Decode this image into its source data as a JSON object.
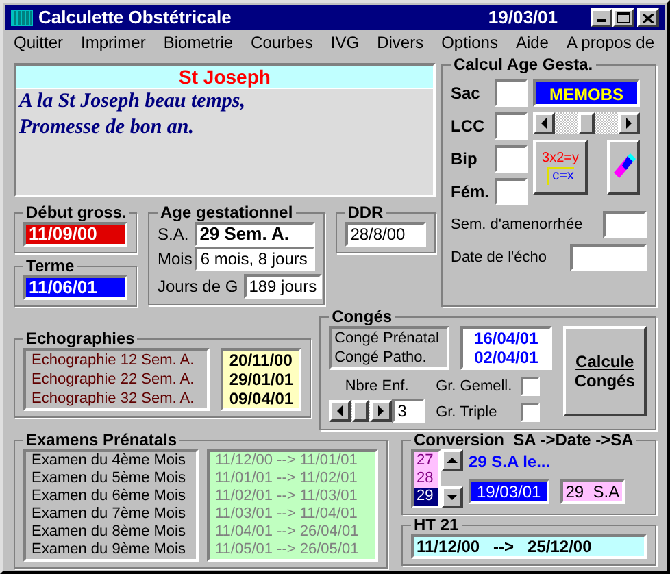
{
  "window": {
    "title": "Calculette Obstétricale",
    "date": "19/03/01"
  },
  "menu": [
    "Quitter",
    "Imprimer",
    "Biometrie",
    "Courbes",
    "IVG",
    "Divers",
    "Options",
    "Aide",
    "A propos de"
  ],
  "saint_panel": {
    "title": "St Joseph",
    "lines": [
      "A la St Joseph beau temps,",
      "Promesse de bon an."
    ]
  },
  "calcul": {
    "title": "Calcul Age Gesta.",
    "fields": [
      {
        "label": "Sac"
      },
      {
        "label": "LCC"
      },
      {
        "label": "Bip"
      },
      {
        "label": "Fém."
      }
    ],
    "memobs": "MEMOBS",
    "slider": {
      "level": 0.5
    },
    "calc_icon": {
      "top": "3x2=y",
      "bottom": "c=x"
    },
    "sem_label": "Sem. d'amenorrhée",
    "echo_label": "Date de l'écho"
  },
  "debut": {
    "title": "Début gross.",
    "value": "11/09/00"
  },
  "terme": {
    "title": "Terme",
    "value": "11/06/01"
  },
  "age": {
    "title": "Age gestationnel",
    "sa_label": "S.A.",
    "sa_value": "29  Sem. A.",
    "mois_label": "Mois",
    "mois_value": "6 mois, 8 jours",
    "jours_label": "Jours de G",
    "jours_value": "189 jours"
  },
  "ddr": {
    "title": "DDR",
    "value": "28/8/00"
  },
  "echographies": {
    "title": "Echographies",
    "items": [
      "Echographie 12 Sem. A.",
      "Echographie 22 Sem. A.",
      "Echographie 32 Sem. A."
    ],
    "dates": [
      "20/11/00",
      "29/01/01",
      "09/04/01"
    ]
  },
  "conges": {
    "title": "Congés",
    "items": [
      "Congé Prénatal",
      "Congé Patho."
    ],
    "dates": [
      "16/04/01",
      "02/04/01"
    ],
    "nbre_label": "Nbre Enf.",
    "nbre_value": "3",
    "slider": {
      "level": 0.5
    },
    "checks": [
      {
        "label": "Gr. Gemell.",
        "checked": false
      },
      {
        "label": "Gr. Triple",
        "checked": false
      }
    ],
    "button": [
      "Calcule",
      "Congés"
    ]
  },
  "examens": {
    "title": "Examens Prénatals",
    "items": [
      "Examen du 4ème Mois",
      "Examen du 5ème Mois",
      "Examen du 6ème Mois",
      "Examen du 7ème Mois",
      "Examen du 8ème Mois",
      "Examen du 9ème Mois"
    ],
    "ranges": [
      "11/12/00 --> 11/01/01",
      "11/01/01 --> 11/02/01",
      "11/02/01 --> 11/03/01",
      "11/03/01 --> 11/04/01",
      "11/04/01 --> 26/04/01",
      "11/05/01 --> 26/05/01"
    ]
  },
  "conversion": {
    "title": "Conversion  SA ->Date ->SA",
    "list": [
      {
        "label": "27",
        "selected": false
      },
      {
        "label": "28",
        "selected": false
      },
      {
        "label": "29",
        "selected": true
      }
    ],
    "caption": "29 S.A le...",
    "date": "19/03/01",
    "sa": "29  S.A"
  },
  "ht21": {
    "title": "HT 21",
    "value": "11/12/00   -->   25/12/00"
  }
}
